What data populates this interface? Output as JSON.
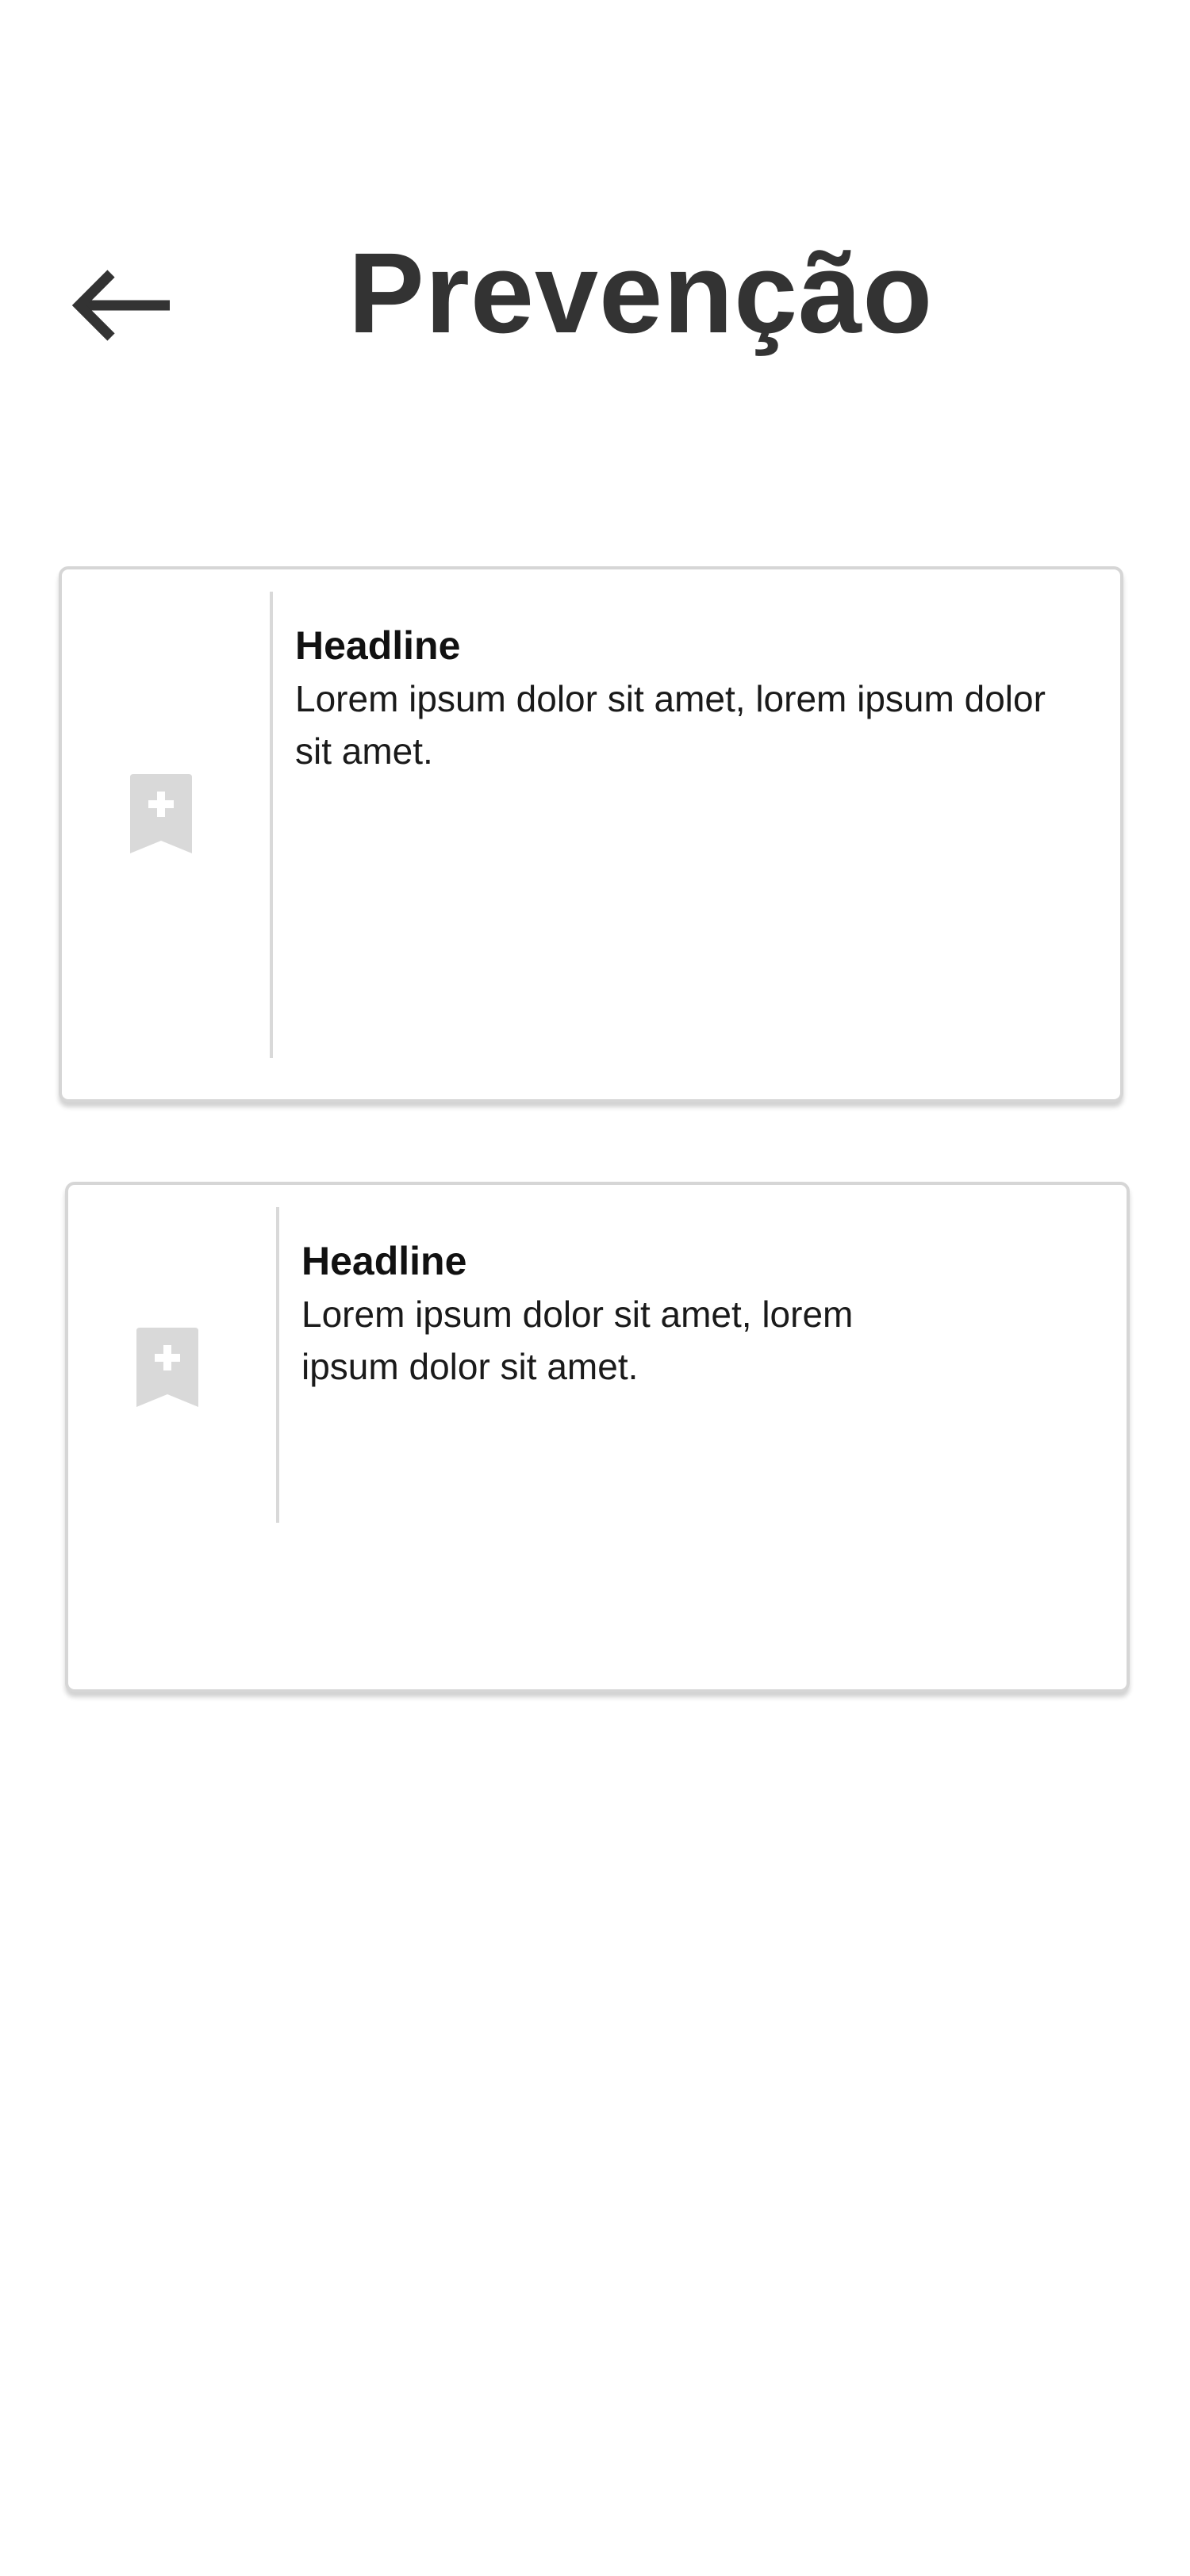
{
  "header": {
    "back_icon": "arrow-left-icon",
    "title": "Prevenção"
  },
  "colors": {
    "title": "#333333",
    "card_border": "#d6d6d6",
    "icon": "#d9d9d9",
    "divider": "#d9d9d9"
  },
  "cards": [
    {
      "icon": "bookmark-plus-icon",
      "headline": "Headline",
      "body": "Lorem ipsum dolor sit amet, lorem ipsum dolor sit amet."
    },
    {
      "icon": "bookmark-plus-icon",
      "headline": "Headline",
      "body": "Lorem ipsum dolor sit amet, lorem ipsum dolor sit amet."
    }
  ]
}
